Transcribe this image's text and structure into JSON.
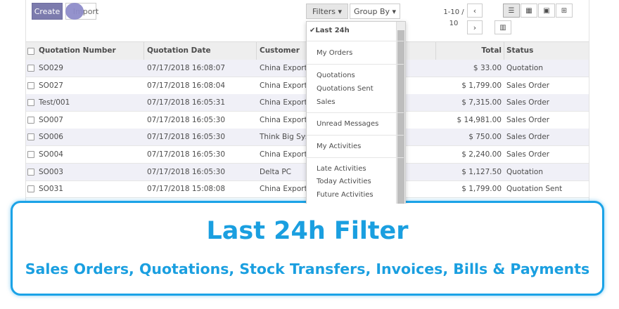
{
  "toolbar": {
    "create_label": "Create",
    "import_label": "Import",
    "filters_label": "Filters ▾",
    "filters_icon": "▼",
    "groupby_label": "Group By ▾",
    "groupby_icon": "≡",
    "pager_text": "1-10 / 10",
    "prev_glyph": "‹",
    "next_glyph": "›",
    "views": [
      {
        "name": "list-view",
        "glyph": "☰",
        "active": true
      },
      {
        "name": "kanban-view",
        "glyph": "▦",
        "active": false
      },
      {
        "name": "calendar-view",
        "glyph": "▣",
        "active": false
      },
      {
        "name": "pivot-view",
        "glyph": "⊞",
        "active": false
      }
    ],
    "graph_glyph": "▥"
  },
  "table": {
    "columns": [
      "Quotation Number",
      "Quotation Date",
      "Customer",
      "Total",
      "Status"
    ],
    "rows": [
      {
        "number": "SO029",
        "date": "07/17/2018 16:08:07",
        "customer": "China Export",
        "total": "$ 33.00",
        "status": "Quotation"
      },
      {
        "number": "SO027",
        "date": "07/17/2018 16:08:04",
        "customer": "China Export",
        "total": "$ 1,799.00",
        "status": "Sales Order"
      },
      {
        "number": "Test/001",
        "date": "07/17/2018 16:05:31",
        "customer": "China Export",
        "total": "$ 7,315.00",
        "status": "Sales Order"
      },
      {
        "number": "SO007",
        "date": "07/17/2018 16:05:30",
        "customer": "China Export",
        "total": "$ 14,981.00",
        "status": "Sales Order"
      },
      {
        "number": "SO006",
        "date": "07/17/2018 16:05:30",
        "customer": "Think Big Syste",
        "total": "$ 750.00",
        "status": "Sales Order"
      },
      {
        "number": "SO004",
        "date": "07/17/2018 16:05:30",
        "customer": "China Export",
        "total": "$ 2,240.00",
        "status": "Sales Order"
      },
      {
        "number": "SO003",
        "date": "07/17/2018 16:05:30",
        "customer": "Delta PC",
        "total": "$ 1,127.50",
        "status": "Quotation"
      },
      {
        "number": "SO031",
        "date": "07/17/2018 15:08:08",
        "customer": "China Export",
        "total": "$ 1,799.00",
        "status": "Quotation Sent"
      }
    ]
  },
  "filters_menu": {
    "items": [
      {
        "label": "✔Last 24h",
        "selected": true
      },
      {
        "label": "My Orders",
        "selected": false
      },
      {
        "label": "Quotations",
        "selected": false
      },
      {
        "label": "Quotations Sent",
        "selected": false
      },
      {
        "label": "Sales",
        "selected": false
      },
      {
        "label": "Unread Messages",
        "selected": false
      },
      {
        "label": "My Activities",
        "selected": false
      },
      {
        "label": "Late Activities",
        "selected": false
      },
      {
        "label": "Today Activities",
        "selected": false
      },
      {
        "label": "Future Activities",
        "selected": false
      }
    ]
  },
  "banner": {
    "title": "Last 24h Filter",
    "subtitle": "Sales Orders, Quotations, Stock Transfers, Invoices, Bills & Payments"
  },
  "colors": {
    "primary": "#7c7bad",
    "banner_blue": "#1a9fe0",
    "row_stripe": "#f0f0f7"
  }
}
